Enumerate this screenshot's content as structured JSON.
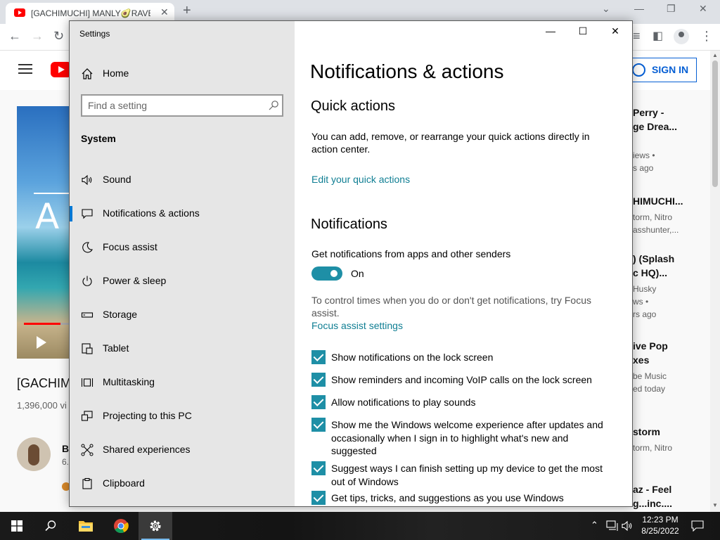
{
  "browser": {
    "tab_title": "[GACHIMUCHI] MANLY🥑RAVE - ",
    "tab_close": "✕",
    "new_tab": "+",
    "win_minimize": "⌄",
    "win_min2": "—",
    "win_restore": "❐",
    "win_close": "✕"
  },
  "youtube": {
    "signin_label": "SIGN IN",
    "video_overlay_text": "A",
    "video_title": "[GACHIM",
    "video_views": "1,396,000 vi",
    "channel_name": "B",
    "channel_subs": "6.",
    "related": [
      {
        "title": "Perry -",
        "line2": "ge Drea...",
        "meta1": "iews •",
        "meta2": "s ago"
      },
      {
        "title": "HIMUCHI...",
        "line2": "",
        "meta1": "torm, Nitro",
        "meta2": "asshunter,..."
      },
      {
        "title": ") (Splash",
        "line2": "c HQ)...",
        "meta1": "Husky",
        "meta2": "ws •",
        "meta3": "rs ago"
      },
      {
        "title": "ive Pop",
        "line2": "xes",
        "meta1": "be Music",
        "meta2": "ed today"
      },
      {
        "title": "storm",
        "line2": "",
        "meta1": "torm, Nitro",
        "meta2": ""
      },
      {
        "title": "az - Feel",
        "line2": "g...inc....",
        "meta1": "",
        "meta2": ""
      }
    ]
  },
  "settings": {
    "window_title": "Settings",
    "home_label": "Home",
    "search_placeholder": "Find a setting",
    "section": "System",
    "nav_items": [
      {
        "label": "Sound"
      },
      {
        "label": "Notifications & actions"
      },
      {
        "label": "Focus assist"
      },
      {
        "label": "Power & sleep"
      },
      {
        "label": "Storage"
      },
      {
        "label": "Tablet"
      },
      {
        "label": "Multitasking"
      },
      {
        "label": "Projecting to this PC"
      },
      {
        "label": "Shared experiences"
      },
      {
        "label": "Clipboard"
      }
    ],
    "page_title": "Notifications & actions",
    "quick_actions": {
      "heading": "Quick actions",
      "description": "You can add, remove, or rearrange your quick actions directly in action center.",
      "link": "Edit your quick actions"
    },
    "notifications": {
      "heading": "Notifications",
      "toggle_label": "Get notifications from apps and other senders",
      "toggle_state": "On",
      "focus_hint": "To control times when you do or don't get notifications, try Focus assist.",
      "focus_link": "Focus assist settings",
      "checkboxes": [
        {
          "label": "Show notifications on the lock screen",
          "checked": true
        },
        {
          "label": "Show reminders and incoming VoIP calls on the lock screen",
          "checked": true
        },
        {
          "label": "Allow notifications to play sounds",
          "checked": true
        },
        {
          "label": "Show me the Windows welcome experience after updates and occasionally when I sign in to highlight what's new and suggested",
          "checked": true
        },
        {
          "label": "Suggest ways I can finish setting up my device to get the most out of Windows",
          "checked": true
        },
        {
          "label": "Get tips, tricks, and suggestions as you use Windows",
          "checked": true
        }
      ]
    }
  },
  "taskbar": {
    "time": "12:23 PM",
    "date": "8/25/2022"
  },
  "colors": {
    "accent": "#0078d4",
    "toggle_on": "#1e8fa6",
    "link": "#0f7e93",
    "youtube_red": "#ff0000"
  }
}
